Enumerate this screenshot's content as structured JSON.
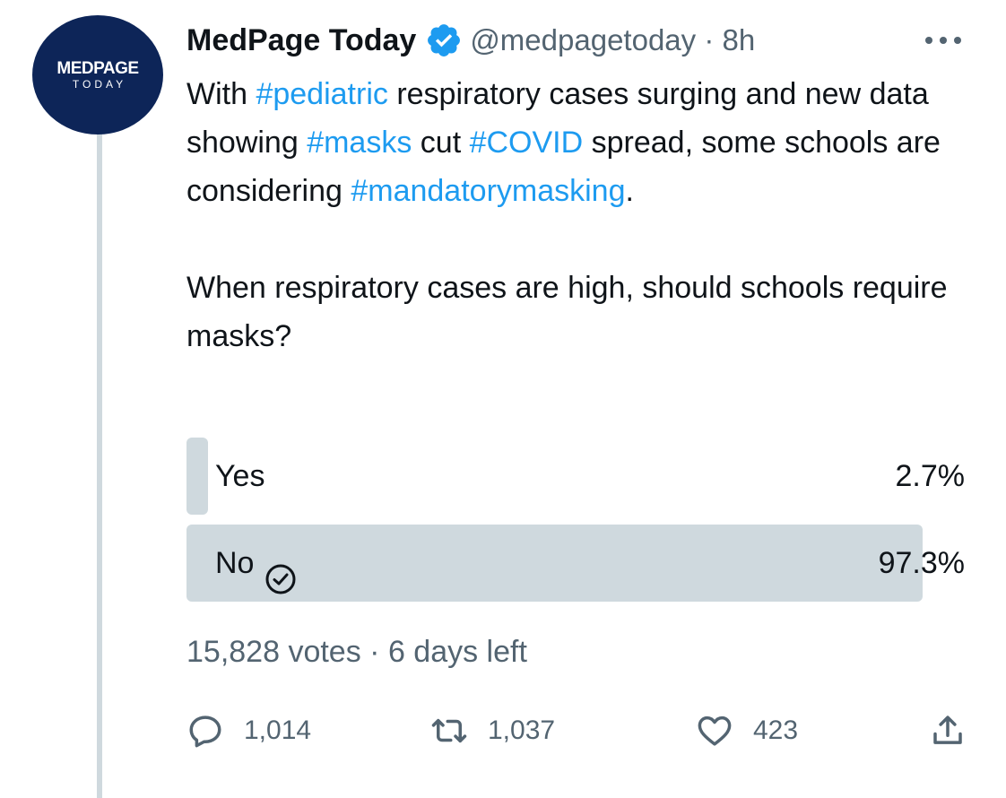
{
  "tweet": {
    "author": {
      "display_name": "MedPage Today",
      "handle": "@medpagetoday",
      "time": "8h",
      "avatar_line1": "MEDPAGE",
      "avatar_line2": "TODAY",
      "verified": true
    },
    "text_parts": [
      {
        "t": "With ",
        "tag": false
      },
      {
        "t": "#pediatric",
        "tag": true
      },
      {
        "t": " respiratory cases surging and new data showing ",
        "tag": false
      },
      {
        "t": "#masks",
        "tag": true
      },
      {
        "t": " cut ",
        "tag": false
      },
      {
        "t": "#COVID",
        "tag": true
      },
      {
        "t": " spread, some schools are considering ",
        "tag": false
      },
      {
        "t": "#mandatorymasking",
        "tag": true
      },
      {
        "t": ".",
        "tag": false
      }
    ],
    "question": "When respiratory cases are high, should schools require masks?",
    "poll": {
      "options": [
        {
          "label": "Yes",
          "percent_text": "2.7%",
          "share": 0.027,
          "selected": false
        },
        {
          "label": "No",
          "percent_text": "97.3%",
          "share": 0.973,
          "selected": true
        }
      ],
      "votes": "15,828 votes",
      "time_left": "6 days left"
    },
    "actions": {
      "replies": "1,014",
      "retweets": "1,037",
      "likes": "423"
    }
  },
  "icons": {
    "verified": "verified-badge-icon",
    "more": "more-horizontal-icon",
    "reply": "reply-icon",
    "retweet": "retweet-icon",
    "like": "heart-icon",
    "share": "share-icon",
    "selected": "check-circle-icon"
  },
  "colors": {
    "hashtag": "#1d9bf0",
    "secondary_text": "#536471",
    "poll_bar": "#cfd9de",
    "avatar_bg": "#0d2558"
  }
}
